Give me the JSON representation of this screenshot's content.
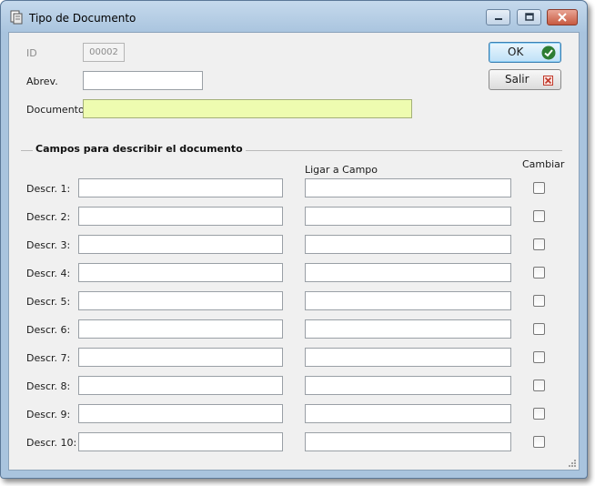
{
  "window": {
    "title": "Tipo de Documento"
  },
  "form": {
    "id_label": "ID",
    "id_value": "00002",
    "abrev_label": "Abrev.",
    "abrev_value": "",
    "documento_label": "Documento",
    "documento_value": ""
  },
  "buttons": {
    "ok_label": "OK",
    "salir_label": "Salir"
  },
  "group": {
    "title": "Campos para describir el documento",
    "link_header": "Ligar a Campo",
    "change_header": "Cambiar",
    "rows": [
      {
        "label": "Descr. 1:",
        "value": "",
        "link": "",
        "checked": false
      },
      {
        "label": "Descr. 2:",
        "value": "",
        "link": "",
        "checked": false
      },
      {
        "label": "Descr. 3:",
        "value": "",
        "link": "",
        "checked": false
      },
      {
        "label": "Descr. 4:",
        "value": "",
        "link": "",
        "checked": false
      },
      {
        "label": "Descr. 5:",
        "value": "",
        "link": "",
        "checked": false
      },
      {
        "label": "Descr. 6:",
        "value": "",
        "link": "",
        "checked": false
      },
      {
        "label": "Descr. 7:",
        "value": "",
        "link": "",
        "checked": false
      },
      {
        "label": "Descr. 8:",
        "value": "",
        "link": "",
        "checked": false
      },
      {
        "label": "Descr. 9:",
        "value": "",
        "link": "",
        "checked": false
      },
      {
        "label": "Descr. 10:",
        "value": "",
        "link": "",
        "checked": false
      }
    ]
  },
  "icons": {
    "app": "document-icon",
    "ok": "check-circle-icon",
    "salir": "red-x-icon"
  },
  "colors": {
    "required_field": "#eefcb0",
    "ok_check": "#2e7d32",
    "salir_x": "#c0392b"
  }
}
